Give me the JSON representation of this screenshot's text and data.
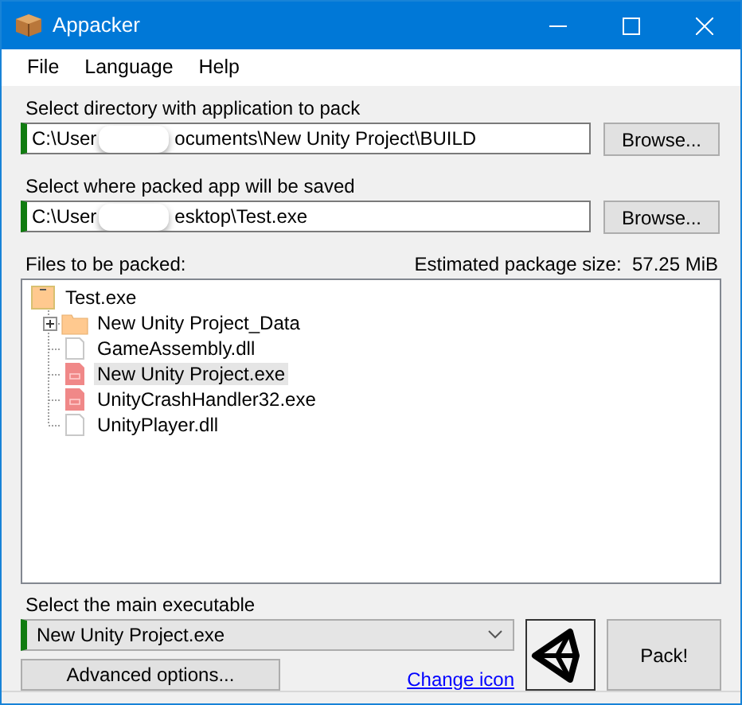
{
  "window": {
    "title": "Appacker"
  },
  "menu": [
    "File",
    "Language",
    "Help"
  ],
  "source": {
    "label": "Select directory with application to pack",
    "value_parts": [
      "C:\\User",
      "ocuments\\New Unity Project\\BUILD"
    ],
    "valid": true,
    "button": "Browse..."
  },
  "target": {
    "label": "Select where packed app will be saved",
    "value_parts": [
      "C:\\User",
      "esktop\\Test.exe"
    ],
    "valid": true,
    "button": "Browse..."
  },
  "files": {
    "label": "Files to be packed:",
    "size_label": "Estimated package size:",
    "size": "57.25 MiB",
    "tree": {
      "name": "Test.exe",
      "kind": "package",
      "selected": false,
      "children": [
        {
          "name": "New Unity Project_Data",
          "kind": "folder",
          "expanded": false,
          "selected": false
        },
        {
          "name": "GameAssembly.dll",
          "kind": "file",
          "selected": false
        },
        {
          "name": "New Unity Project.exe",
          "kind": "exe",
          "selected": true
        },
        {
          "name": "UnityCrashHandler32.exe",
          "kind": "exe",
          "selected": false
        },
        {
          "name": "UnityPlayer.dll",
          "kind": "file",
          "selected": false
        }
      ]
    }
  },
  "main": {
    "label": "Select the main executable",
    "value": "New Unity Project.exe",
    "valid": true
  },
  "advanced_button": "Advanced options...",
  "change_icon_link": "Change icon",
  "pack_button": "Pack!"
}
